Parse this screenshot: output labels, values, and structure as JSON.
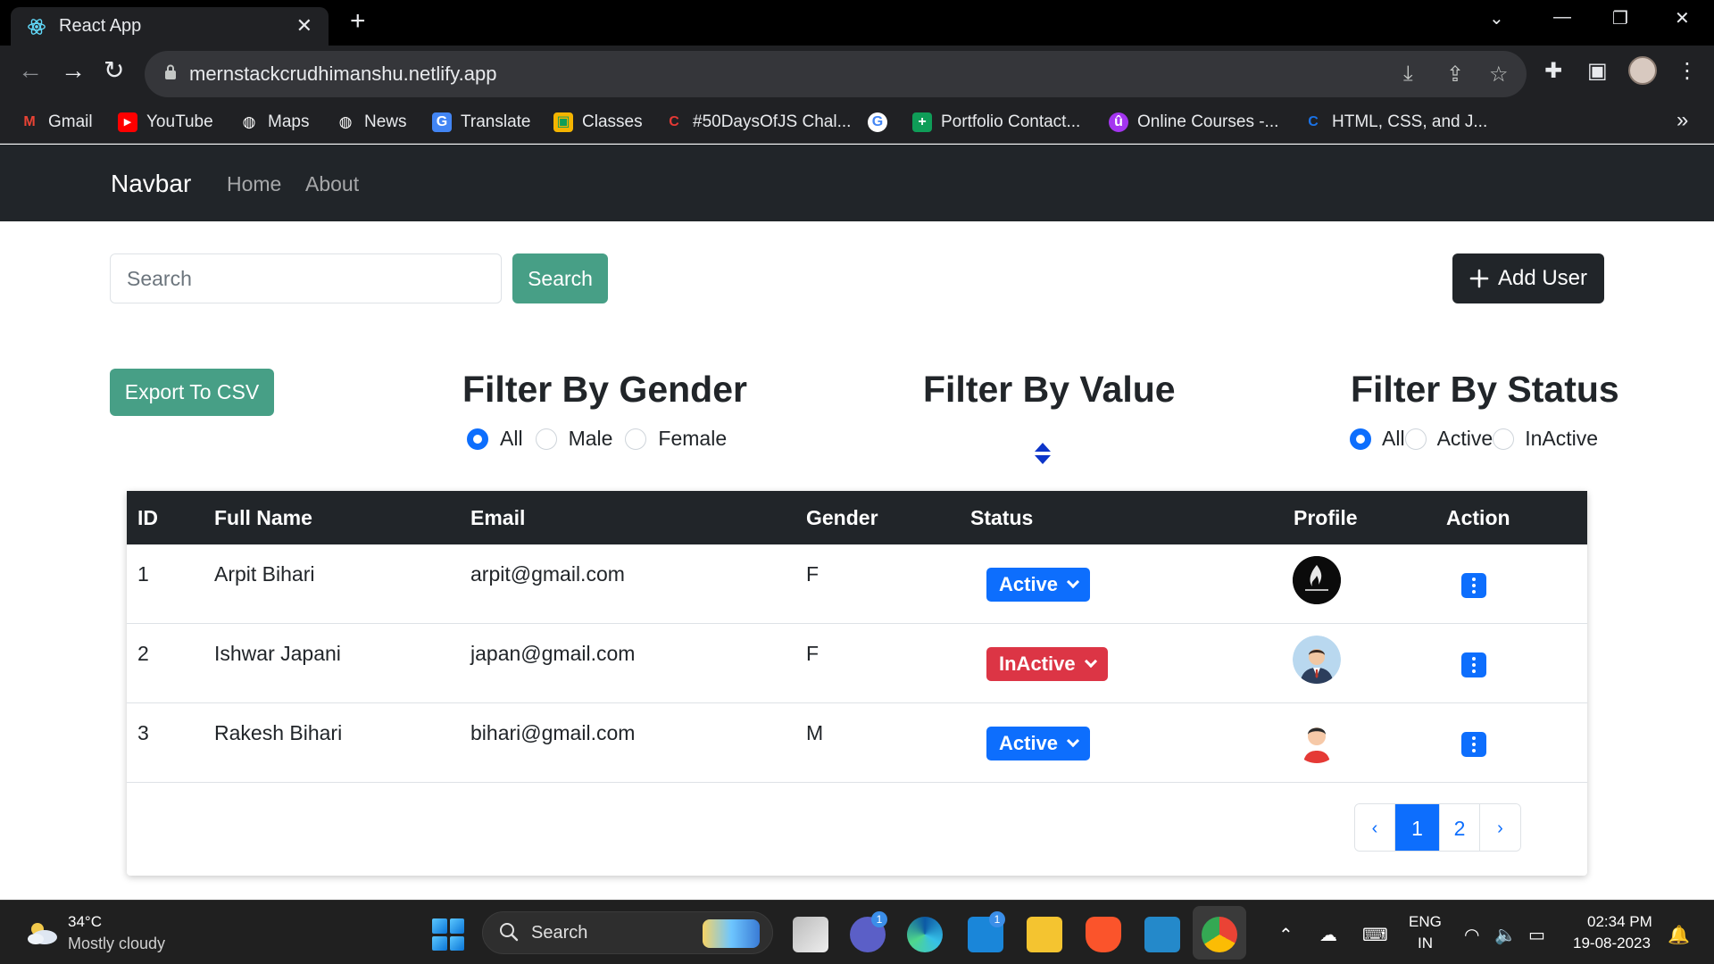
{
  "browser": {
    "tab_title": "React App",
    "tab_close": "✕",
    "new_tab": "+",
    "url": "mernstackcrudhimanshu.netlify.app",
    "bookmarks": [
      {
        "label": "Gmail",
        "icon": "gmail-icon",
        "color": "#ea4335",
        "glyph": "M"
      },
      {
        "label": "YouTube",
        "icon": "youtube-icon",
        "color": "#ff0000",
        "glyph": "▶"
      },
      {
        "label": "Maps",
        "icon": "globe-icon",
        "color": "#ffffff",
        "glyph": "🌐"
      },
      {
        "label": "News",
        "icon": "globe-icon",
        "color": "#ffffff",
        "glyph": "🌐"
      },
      {
        "label": "Translate",
        "icon": "translate-icon",
        "color": "#4285f4",
        "glyph": "G"
      },
      {
        "label": "Classes",
        "icon": "classroom-icon",
        "color": "#f4b400",
        "glyph": "▣"
      },
      {
        "label": "#50DaysOfJS Chal...",
        "icon": "c-logo-icon",
        "color": "#e53935",
        "glyph": "C"
      },
      {
        "label": "",
        "icon": "google-icon",
        "color": "#ffffff",
        "glyph": "G"
      },
      {
        "label": "Portfolio Contact...",
        "icon": "sheets-icon",
        "color": "#0f9d58",
        "glyph": "+"
      },
      {
        "label": "Online Courses -...",
        "icon": "udemy-icon",
        "color": "#a435f0",
        "glyph": "û"
      },
      {
        "label": "HTML, CSS, and J...",
        "icon": "c-logo-icon",
        "color": "#1a73e8",
        "glyph": "C"
      }
    ],
    "more": "»"
  },
  "navbar": {
    "brand": "Navbar",
    "links": [
      "Home",
      "About"
    ]
  },
  "search": {
    "placeholder": "Search",
    "value": "",
    "button": "Search"
  },
  "add_user": {
    "label": "Add User",
    "icon": "plus-icon"
  },
  "export_csv": "Export To CSV",
  "filters": {
    "gender": {
      "title": "Filter By Gender",
      "options": [
        "All",
        "Male",
        "Female"
      ],
      "selected": "All"
    },
    "value": {
      "title": "Filter By Value",
      "icon": "sort-icon"
    },
    "status": {
      "title": "Filter By Status",
      "options": [
        "All",
        "Active",
        "InActive"
      ],
      "selected": "All"
    }
  },
  "table": {
    "headers": [
      "ID",
      "Full Name",
      "Email",
      "Gender",
      "Status",
      "Profile",
      "Action"
    ],
    "rows": [
      {
        "id": "1",
        "name": "Arpit Bihari",
        "email": "arpit@gmail.com",
        "gender": "F",
        "status": "Active",
        "profile": "dark-logo-avatar"
      },
      {
        "id": "2",
        "name": "Ishwar Japani",
        "email": "japan@gmail.com",
        "gender": "F",
        "status": "InActive",
        "profile": "businessman-avatar"
      },
      {
        "id": "3",
        "name": "Rakesh Bihari",
        "email": "bihari@gmail.com",
        "gender": "M",
        "status": "Active",
        "profile": "red-shirt-avatar"
      }
    ]
  },
  "pagination": {
    "prev": "‹",
    "pages": [
      "1",
      "2"
    ],
    "current": "1",
    "next": "›"
  },
  "colors": {
    "primary": "#0d6efd",
    "danger": "#dc3545",
    "teal": "#479f86",
    "dark": "#212529"
  },
  "taskbar": {
    "weather_temp": "34°C",
    "weather_desc": "Mostly cloudy",
    "search_label": "Search",
    "teams_badge": "1",
    "mail_badge": "1",
    "language": "ENG",
    "region": "IN",
    "time": "02:34 PM",
    "date": "19-08-2023"
  }
}
